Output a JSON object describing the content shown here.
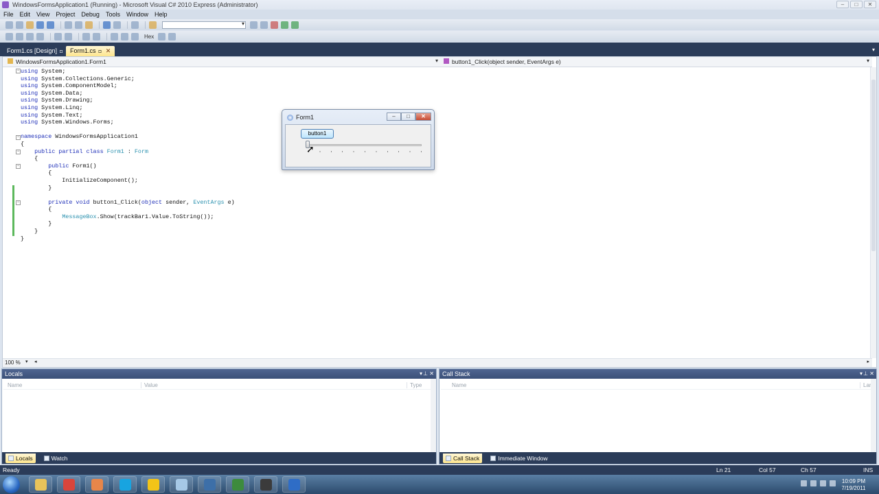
{
  "window": {
    "title": "WindowsFormsApplication1 (Running) - Microsoft Visual C# 2010 Express (Administrator)"
  },
  "menu": [
    "File",
    "Edit",
    "View",
    "Project",
    "Debug",
    "Tools",
    "Window",
    "Help"
  ],
  "toolbar2": {
    "hex_label": "Hex"
  },
  "tabs": [
    {
      "label": "Form1.cs [Design]",
      "active": false
    },
    {
      "label": "Form1.cs",
      "active": true
    }
  ],
  "editor": {
    "nav_left": "WindowsFormsApplication1.Form1",
    "nav_right": "button1_Click(object sender, EventArgs e)",
    "zoom": "100 %",
    "code_lines": [
      [
        "kw:using",
        "t: System;"
      ],
      [
        "kw:using",
        "t: System.Collections.Generic;"
      ],
      [
        "kw:using",
        "t: System.ComponentModel;"
      ],
      [
        "kw:using",
        "t: System.Data;"
      ],
      [
        "kw:using",
        "t: System.Drawing;"
      ],
      [
        "kw:using",
        "t: System.Linq;"
      ],
      [
        "kw:using",
        "t: System.Text;"
      ],
      [
        "kw:using",
        "t: System.Windows.Forms;"
      ],
      [],
      [
        "kw:namespace",
        "t: WindowsFormsApplication1"
      ],
      [
        "t:{"
      ],
      [
        "t:    ",
        "kw:public partial class",
        "t: ",
        "ty:Form1",
        "t: : ",
        "ty:Form"
      ],
      [
        "t:    {"
      ],
      [
        "t:        ",
        "kw:public",
        "t: Form1()"
      ],
      [
        "t:        {"
      ],
      [
        "t:            InitializeComponent();"
      ],
      [
        "t:        }"
      ],
      [],
      [
        "t:        ",
        "kw:private void",
        "t: button1_Click(",
        "kw:object",
        "t: sender, ",
        "ty:EventArgs",
        "t: e)"
      ],
      [
        "t:        {"
      ],
      [
        "t:            ",
        "ty:MessageBox",
        "t:.Show(trackBar1.Value.ToString());"
      ],
      [
        "t:        }"
      ],
      [
        "t:    }"
      ],
      [
        "t:}"
      ]
    ]
  },
  "form1": {
    "title": "Form1",
    "button_label": "button1",
    "trackbar_value": 0,
    "trackbar_max": 10
  },
  "locals": {
    "title": "Locals",
    "columns": [
      "Name",
      "Value",
      "Type"
    ],
    "tabs": [
      "Locals",
      "Watch"
    ]
  },
  "callstack": {
    "title": "Call Stack",
    "columns": [
      "Name",
      "Lang"
    ],
    "tabs": [
      "Call Stack",
      "Immediate Window"
    ]
  },
  "status": {
    "text": "Ready",
    "ln": "Ln 21",
    "col": "Col 57",
    "ch": "Ch 57",
    "mode": "INS"
  },
  "clock": {
    "time": "10:09 PM",
    "date": "7/19/2011"
  },
  "taskbar_icons": [
    {
      "name": "explorer-icon",
      "color": "#e8c35a"
    },
    {
      "name": "chrome-icon",
      "color": "#d9453b"
    },
    {
      "name": "paint-icon",
      "color": "#e7864a"
    },
    {
      "name": "skype-icon",
      "color": "#18a4e0"
    },
    {
      "name": "aim-icon",
      "color": "#f3c417"
    },
    {
      "name": "notepad-icon",
      "color": "#a6c8e6"
    },
    {
      "name": "snipping-icon",
      "color": "#3d6fa8"
    },
    {
      "name": "csharp-icon",
      "color": "#3d8b3d"
    },
    {
      "name": "video-icon",
      "color": "#3b3b3b"
    },
    {
      "name": "app-icon",
      "color": "#2f6dc6"
    }
  ]
}
